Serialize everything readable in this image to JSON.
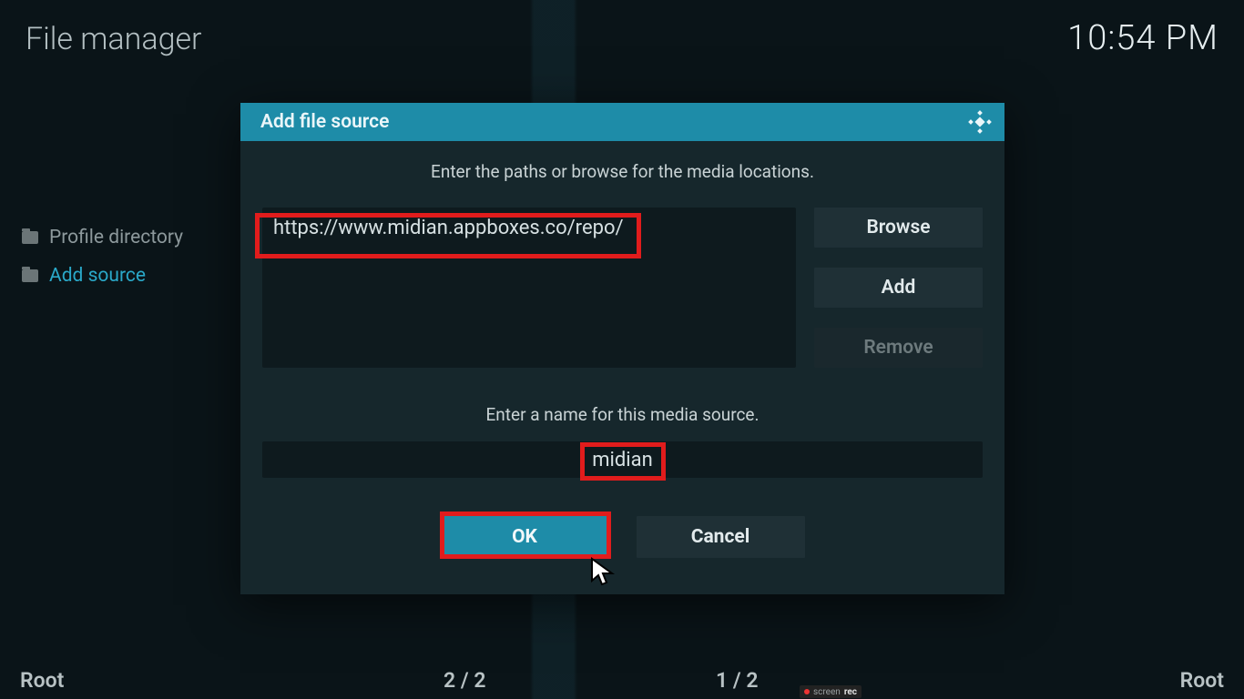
{
  "header": {
    "title": "File manager",
    "clock": "10:54 PM"
  },
  "sidebar": {
    "items": [
      {
        "label": "Profile directory",
        "selected": false
      },
      {
        "label": "Add source",
        "selected": true
      }
    ]
  },
  "dialog": {
    "title": "Add file source",
    "instruction_paths": "Enter the paths or browse for the media locations.",
    "path_value": "https://www.midian.appboxes.co/repo/",
    "buttons": {
      "browse": "Browse",
      "add": "Add",
      "remove": "Remove"
    },
    "instruction_name": "Enter a name for this media source.",
    "name_value": "midian",
    "ok": "OK",
    "cancel": "Cancel"
  },
  "footer": {
    "left": "Root",
    "center1": "2 / 2",
    "center2": "1 / 2",
    "right": "Root"
  },
  "watermark": {
    "prefix": "screen",
    "suffix": "rec"
  }
}
